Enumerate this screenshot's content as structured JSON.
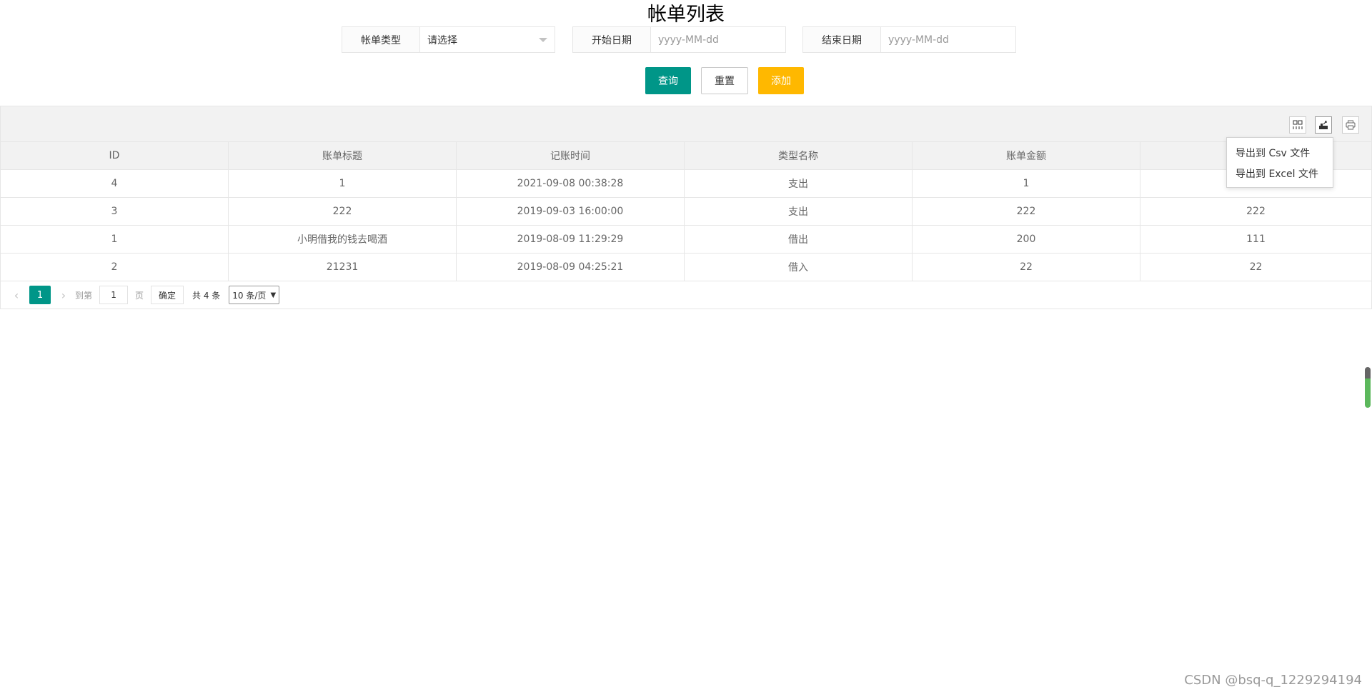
{
  "page_title": "帐单列表",
  "filters": {
    "bill_type": {
      "label": "帐单类型",
      "value": "请选择"
    },
    "start_date": {
      "label": "开始日期",
      "placeholder": "yyyy-MM-dd"
    },
    "end_date": {
      "label": "结束日期",
      "placeholder": "yyyy-MM-dd"
    }
  },
  "buttons": {
    "query": "查询",
    "reset": "重置",
    "add": "添加"
  },
  "table": {
    "headers": [
      "ID",
      "账单标题",
      "记账时间",
      "类型名称",
      "账单金额",
      ""
    ],
    "rows": [
      [
        "4",
        "1",
        "2021-09-08 00:38:28",
        "支出",
        "1",
        ""
      ],
      [
        "3",
        "222",
        "2019-09-03 16:00:00",
        "支出",
        "222",
        "222"
      ],
      [
        "1",
        "小明借我的钱去喝酒",
        "2019-08-09 11:29:29",
        "借出",
        "200",
        "111"
      ],
      [
        "2",
        "21231",
        "2019-08-09 04:25:21",
        "借入",
        "22",
        "22"
      ]
    ]
  },
  "pager": {
    "current": "1",
    "goto_label": "到第",
    "goto_value": "1",
    "page_unit": "页",
    "confirm": "确定",
    "total": "共 4 条",
    "page_size": "10 条/页"
  },
  "export_menu": {
    "csv": "导出到 Csv 文件",
    "excel": "导出到 Excel 文件"
  },
  "icons": {
    "columns": "columns-icon",
    "export": "export-icon",
    "print": "print-icon"
  },
  "colors": {
    "primary": "#009688",
    "warn": "#FFB800"
  },
  "watermark": "CSDN @bsq-q_1229294194"
}
